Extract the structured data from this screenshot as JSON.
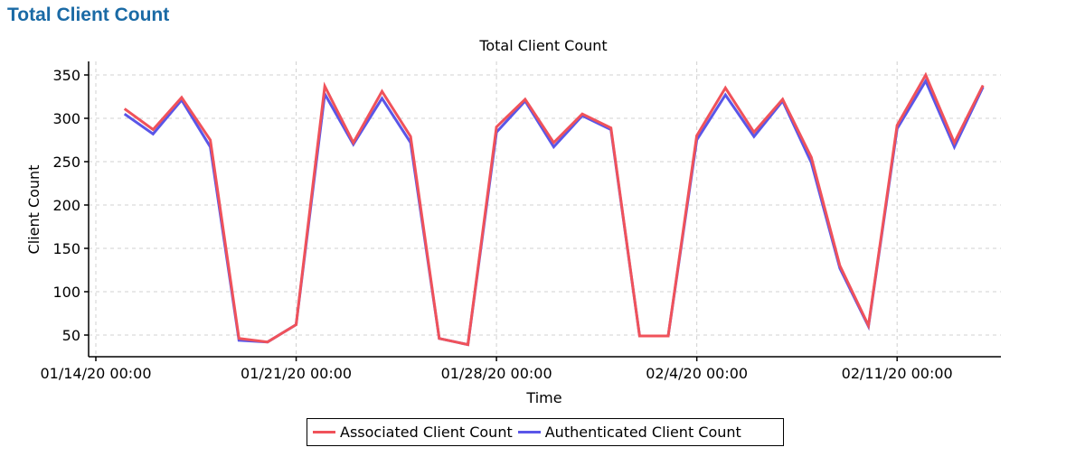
{
  "page": {
    "title": "Total Client Count"
  },
  "chart_data": {
    "type": "line",
    "title": "Total Client Count",
    "xlabel": "Time",
    "ylabel": "Client Count",
    "x": [
      "01/15/20",
      "01/16/20",
      "01/17/20",
      "01/18/20",
      "01/19/20",
      "01/20/20",
      "01/21/20",
      "01/22/20",
      "01/23/20",
      "01/24/20",
      "01/25/20",
      "01/26/20",
      "01/27/20",
      "01/28/20",
      "01/29/20",
      "01/30/20",
      "01/31/20",
      "02/1/20",
      "02/2/20",
      "02/3/20",
      "02/4/20",
      "02/5/20",
      "02/6/20",
      "02/7/20",
      "02/8/20",
      "02/9/20",
      "02/10/20",
      "02/11/20",
      "02/12/20",
      "02/13/20",
      "02/14/20"
    ],
    "x_ticks": [
      "01/14/20 00:00",
      "01/21/20 00:00",
      "01/28/20 00:00",
      "02/4/20 00:00",
      "02/11/20 00:00"
    ],
    "y_ticks": [
      50,
      100,
      150,
      200,
      250,
      300,
      350
    ],
    "ylim": [
      23,
      366
    ],
    "grid": true,
    "legend_position": "bottom-center",
    "series": [
      {
        "name": "Associated Client Count",
        "color": "#f0525a",
        "values": [
          311,
          287,
          324,
          275,
          46,
          42,
          62,
          337,
          272,
          331,
          279,
          46,
          39,
          290,
          322,
          272,
          305,
          289,
          49,
          49,
          280,
          335,
          284,
          322,
          255,
          130,
          61,
          292,
          350,
          272,
          338
        ]
      },
      {
        "name": "Authenticated Client Count",
        "color": "#5a56e8",
        "values": [
          305,
          282,
          321,
          267,
          44,
          42,
          62,
          328,
          270,
          323,
          272,
          46,
          39,
          284,
          320,
          267,
          303,
          287,
          49,
          49,
          275,
          327,
          279,
          320,
          249,
          127,
          60,
          288,
          343,
          267,
          336
        ]
      }
    ]
  }
}
